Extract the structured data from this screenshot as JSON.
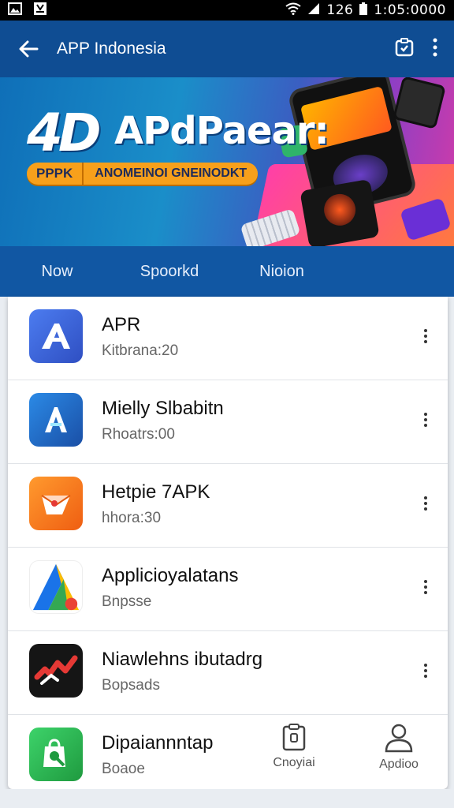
{
  "status_bar": {
    "time": "1:05:0000",
    "battery": "126",
    "icons": [
      "gallery-icon",
      "download-icon",
      "wifi-icon",
      "signal-icon",
      "battery-icon"
    ]
  },
  "app_bar": {
    "title": "APP Indonesia",
    "icons": [
      "back-arrow-icon",
      "share-icon",
      "more-vert-icon"
    ]
  },
  "banner": {
    "logo": "4D",
    "headline": "APdPaear:",
    "tag_left": "PPPK",
    "tag_right": "ANOMEINOI GNEINODKT"
  },
  "tabs": [
    {
      "label": "Now"
    },
    {
      "label": "Spoorkd"
    },
    {
      "label": "Nioion"
    }
  ],
  "apps": [
    {
      "name": "APR",
      "subtitle": "Kitbrana:20",
      "icon": "app-a-icon",
      "color": "#3a63d8"
    },
    {
      "name": "Mielly Slbabitn",
      "subtitle": "Rhoatrs:00",
      "icon": "app-a-blue-icon",
      "color": "#1e72c8"
    },
    {
      "name": "Hetpie 7APK",
      "subtitle": "hhora:30",
      "icon": "envelope-icon",
      "color": "#f07a1a"
    },
    {
      "name": "Applicioyalatans",
      "subtitle": "Bnpsse",
      "icon": "triangle-color-icon",
      "color": "#34a853"
    },
    {
      "name": "Niawlehns ibutadrg",
      "subtitle": "Bopsads",
      "icon": "red-swoosh-icon",
      "color": "#1a1a1a"
    },
    {
      "name": "Dipaiannntap",
      "subtitle": "Boaoe",
      "icon": "green-bag-icon",
      "color": "#2eb34f"
    }
  ],
  "bottom_nav": [
    {
      "label": "Cnoyiai",
      "icon": "clipboard-icon"
    },
    {
      "label": "Apdioo",
      "icon": "person-icon"
    }
  ]
}
